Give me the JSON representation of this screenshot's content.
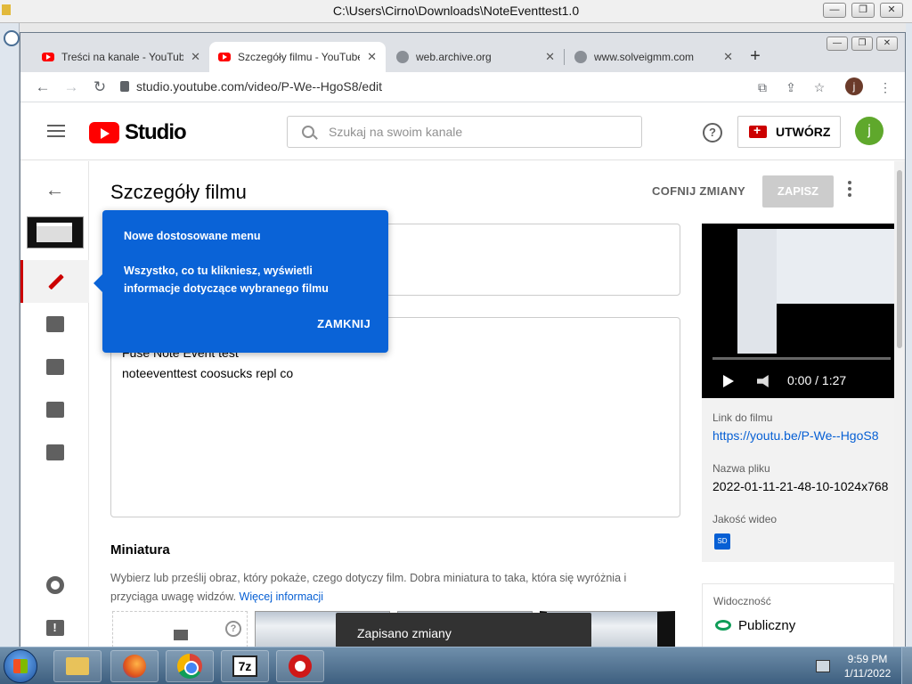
{
  "os": {
    "window_title": "C:\\Users\\Cirno\\Downloads\\NoteEventtest1.0"
  },
  "browser": {
    "tabs": [
      {
        "label": "Treści na kanale - YouTube",
        "icon": "youtube-icon",
        "active": false
      },
      {
        "label": "Szczegóły filmu - YouTube",
        "icon": "youtube-icon",
        "active": true
      },
      {
        "label": "web.archive.org",
        "icon": "globe-icon",
        "active": false
      },
      {
        "label": "www.solveigmm.com",
        "icon": "globe-icon",
        "active": false
      }
    ],
    "url": "studio.youtube.com/video/P-We--HgoS8/edit",
    "profile_initial": "j"
  },
  "studio": {
    "logo_text": "Studio",
    "search_placeholder": "Szukaj na swoim kanale",
    "create_label": "UTWÓRZ",
    "avatar_initial": "j",
    "page_title": "Szczegóły filmu",
    "undo_label": "COFNIJ ZMIANY",
    "save_label": "ZAPISZ",
    "description": {
      "line1": "Fuse Note Event test",
      "line2": "noteeventtest coosucks repl co"
    },
    "thumbnail": {
      "heading": "Miniatura",
      "text": "Wybierz lub prześlij obraz, który pokaże, czego dotyczy film. Dobra miniatura to taka, która się wyróżnia i przyciąga uwagę widzów.",
      "more_link": "Więcej informacji"
    },
    "preview": {
      "time": "0:00 / 1:27",
      "link_label": "Link do filmu",
      "link_value": "https://youtu.be/P-We--HgoS8",
      "filename_label": "Nazwa pliku",
      "filename_value": "2022-01-11-21-48-10-1024x768",
      "quality_label": "Jakość wideo",
      "quality_badge": "SD"
    },
    "visibility": {
      "label": "Widoczność",
      "value": "Publiczny"
    },
    "tooltip": {
      "title": "Nowe dostosowane menu",
      "body": "Wszystko, co tu klikniesz, wyświetli informacje dotyczące wybranego filmu",
      "close": "ZAMKNIJ"
    },
    "snackbar": "Zapisano zmiany"
  },
  "taskbar": {
    "time": "9:59 PM",
    "date": "1/11/2022",
    "seven_zip": "7z"
  },
  "colors": {
    "brand_red": "#ff0000",
    "tooltip_blue": "#0a63d7",
    "link_blue": "#065fd4"
  }
}
